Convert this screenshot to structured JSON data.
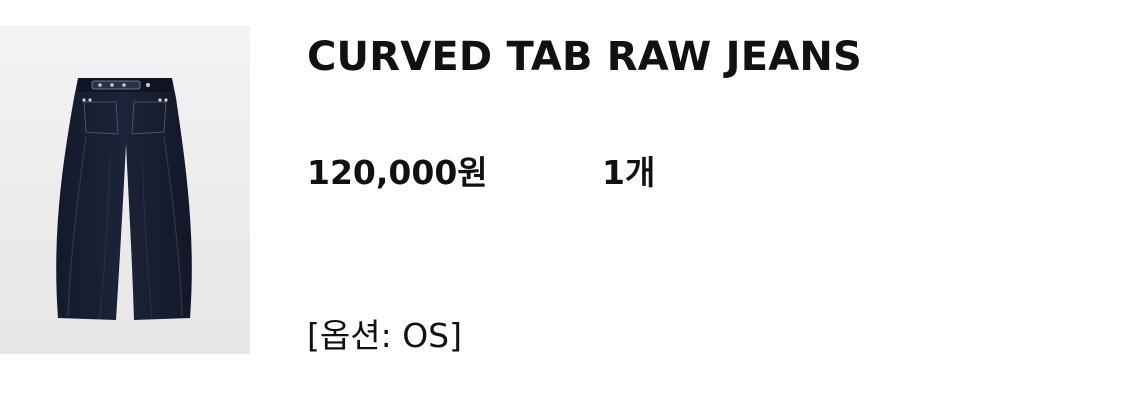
{
  "product": {
    "image_icon": "jeans-product-photo",
    "name": "CURVED TAB RAW JEANS",
    "price": "120,000원",
    "quantity": "1개",
    "option": "[옵션: OS]"
  }
}
